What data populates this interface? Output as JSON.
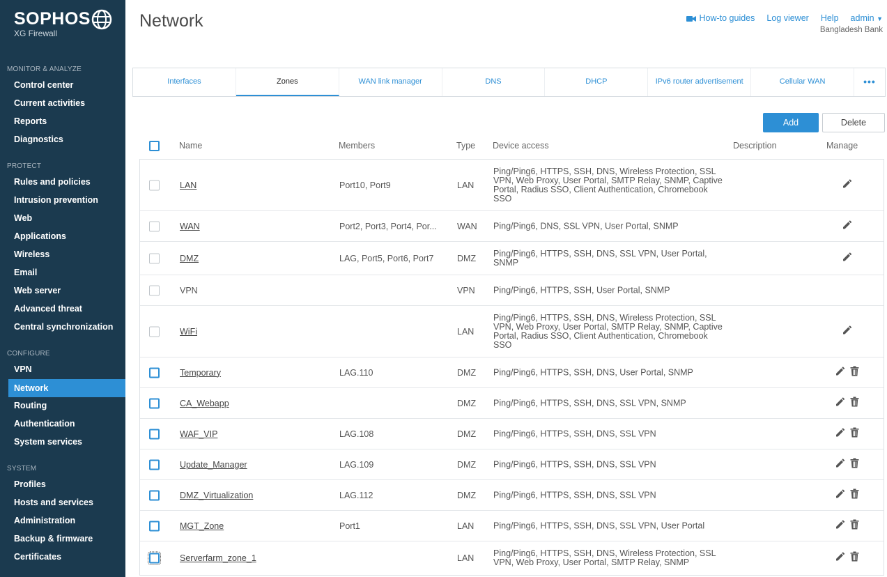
{
  "brand": {
    "name": "SOPHOS",
    "product": "XG Firewall"
  },
  "sidebar": {
    "sections": [
      {
        "title": "MONITOR & ANALYZE",
        "items": [
          "Control center",
          "Current activities",
          "Reports",
          "Diagnostics"
        ]
      },
      {
        "title": "PROTECT",
        "items": [
          "Rules and policies",
          "Intrusion prevention",
          "Web",
          "Applications",
          "Wireless",
          "Email",
          "Web server",
          "Advanced threat",
          "Central synchronization"
        ]
      },
      {
        "title": "CONFIGURE",
        "items": [
          "VPN",
          "Network",
          "Routing",
          "Authentication",
          "System services"
        ]
      },
      {
        "title": "SYSTEM",
        "items": [
          "Profiles",
          "Hosts and services",
          "Administration",
          "Backup & firmware",
          "Certificates"
        ]
      }
    ],
    "active_item": "Network"
  },
  "header": {
    "title": "Network",
    "links": {
      "howto": "How-to guides",
      "log": "Log viewer",
      "help": "Help",
      "user": "admin"
    },
    "org": "Bangladesh Bank"
  },
  "tabs": [
    "Interfaces",
    "Zones",
    "WAN link manager",
    "DNS",
    "DHCP",
    "IPv6 router advertisement",
    "Cellular WAN",
    "•••"
  ],
  "active_tab": "Zones",
  "buttons": {
    "add": "Add",
    "delete": "Delete"
  },
  "table": {
    "columns": {
      "name": "Name",
      "members": "Members",
      "type": "Type",
      "access": "Device access",
      "description": "Description",
      "manage": "Manage"
    },
    "rows": [
      {
        "name": "LAN",
        "members": "Port10, Port9",
        "type": "LAN",
        "access": "Ping/Ping6, HTTPS, SSH, DNS, Wireless Protection, SSL VPN, Web Proxy, User Portal, SMTP Relay, SNMP, Captive Portal, Radius SSO, Client Authentication, Chromebook SSO",
        "selectable": false,
        "editable": true,
        "deletable": false
      },
      {
        "name": "WAN",
        "members": "Port2, Port3, Port4, Por...",
        "type": "WAN",
        "access": "Ping/Ping6, DNS, SSL VPN, User Portal, SNMP",
        "selectable": false,
        "editable": true,
        "deletable": false
      },
      {
        "name": "DMZ",
        "members": "LAG, Port5, Port6, Port7",
        "type": "DMZ",
        "access": "Ping/Ping6, HTTPS, SSH, DNS, SSL VPN, User Portal, SNMP",
        "selectable": false,
        "editable": true,
        "deletable": false
      },
      {
        "name": "VPN",
        "members": "",
        "type": "VPN",
        "access": "Ping/Ping6, HTTPS, SSH, User Portal, SNMP",
        "selectable": false,
        "editable": false,
        "deletable": false
      },
      {
        "name": "WiFi",
        "members": "",
        "type": "LAN",
        "access": "Ping/Ping6, HTTPS, SSH, DNS, Wireless Protection, SSL VPN, Web Proxy, User Portal, SMTP Relay, SNMP, Captive Portal, Radius SSO, Client Authentication, Chromebook SSO",
        "selectable": false,
        "editable": true,
        "deletable": false
      },
      {
        "name": "Temporary",
        "members": "LAG.110",
        "type": "DMZ",
        "access": "Ping/Ping6, HTTPS, SSH, DNS, User Portal, SNMP",
        "selectable": true,
        "editable": true,
        "deletable": true
      },
      {
        "name": "CA_Webapp",
        "members": "",
        "type": "DMZ",
        "access": "Ping/Ping6, HTTPS, SSH, DNS, SSL VPN, SNMP",
        "selectable": true,
        "editable": true,
        "deletable": true
      },
      {
        "name": "WAF_VIP",
        "members": "LAG.108",
        "type": "DMZ",
        "access": "Ping/Ping6, HTTPS, SSH, DNS, SSL VPN",
        "selectable": true,
        "editable": true,
        "deletable": true
      },
      {
        "name": "Update_Manager",
        "members": "LAG.109",
        "type": "DMZ",
        "access": "Ping/Ping6, HTTPS, SSH, DNS, SSL VPN",
        "selectable": true,
        "editable": true,
        "deletable": true
      },
      {
        "name": "DMZ_Virtualization",
        "members": "LAG.112",
        "type": "DMZ",
        "access": "Ping/Ping6, HTTPS, SSH, DNS, SSL VPN",
        "selectable": true,
        "editable": true,
        "deletable": true
      },
      {
        "name": "MGT_Zone",
        "members": "Port1",
        "type": "LAN",
        "access": "Ping/Ping6, HTTPS, SSH, DNS, SSL VPN, User Portal",
        "selectable": true,
        "editable": true,
        "deletable": true
      },
      {
        "name": "Serverfarm_zone_1",
        "members": "",
        "type": "LAN",
        "access": "Ping/Ping6, HTTPS, SSH, DNS, Wireless Protection, SSL VPN, Web Proxy, User Portal, SMTP Relay, SNMP",
        "selectable": true,
        "editable": true,
        "deletable": true
      }
    ]
  },
  "colors": {
    "sidebar_bg": "#1b3a4f",
    "accent": "#2d8fd5"
  }
}
